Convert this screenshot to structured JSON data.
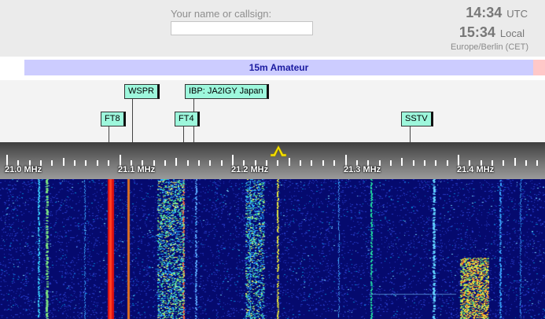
{
  "header": {
    "name_label": "Your name or callsign:",
    "name_value": "",
    "utc_time": "14:34",
    "utc_label": "UTC",
    "local_time": "15:34",
    "local_label": "Local",
    "timezone": "Europe/Berlin (CET)"
  },
  "band": {
    "label": "15m Amateur"
  },
  "markers": {
    "ft8": "FT8",
    "wspr": "WSPR",
    "ibp": "IBP: JA2IGY Japan",
    "ft4": "FT4",
    "sstv": "SSTV"
  },
  "scale": {
    "labels": [
      "21.0 MHz",
      "21.1 MHz",
      "21.2 MHz",
      "21.3 MHz",
      "21.4 MHz"
    ]
  },
  "passband": {
    "icon": "passband-caret-icon",
    "color": "#f5e000"
  },
  "colors": {
    "band_fill": "#ccccff",
    "band_text": "#1a1aa0",
    "marker_fill": "#9df7dc",
    "waterfall_bg": "#050a6e"
  }
}
